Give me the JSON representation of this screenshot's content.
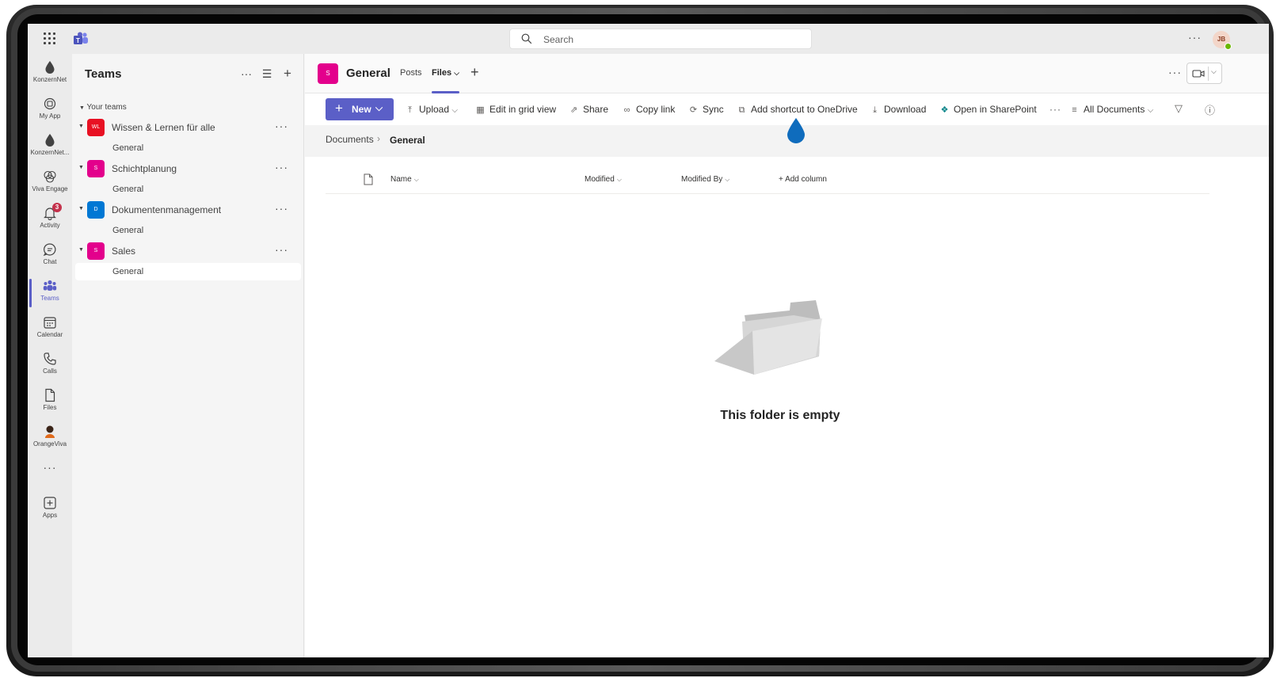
{
  "topbar": {
    "search_placeholder": "Search",
    "user_initials": "JB"
  },
  "rail": {
    "items": [
      {
        "label": "KonzernNet",
        "icon": "drop-icon"
      },
      {
        "label": "My App",
        "icon": "app-icon"
      },
      {
        "label": "KonzernNet...",
        "icon": "drop-icon"
      },
      {
        "label": "Viva Engage",
        "icon": "viva-engage-icon"
      },
      {
        "label": "Activity",
        "icon": "bell-icon",
        "badge": "3"
      },
      {
        "label": "Chat",
        "icon": "chat-icon"
      },
      {
        "label": "Teams",
        "icon": "teams-icon"
      },
      {
        "label": "Calendar",
        "icon": "calendar-icon"
      },
      {
        "label": "Calls",
        "icon": "phone-icon"
      },
      {
        "label": "Files",
        "icon": "file-icon"
      },
      {
        "label": "OrangeViva",
        "icon": "avatar-icon"
      },
      {
        "label": "",
        "icon": "more-icon"
      },
      {
        "label": "Apps",
        "icon": "add-app-icon"
      }
    ]
  },
  "panel": {
    "title": "Teams",
    "section_label": "Your teams",
    "teams": [
      {
        "initials": "WL",
        "name": "Wissen & Lernen für alle",
        "color": "#e81123",
        "channel": "General"
      },
      {
        "initials": "S",
        "name": "Schichtplanung",
        "color": "#e3008c",
        "channel": "General"
      },
      {
        "initials": "D",
        "name": "Dokumentenmanagement",
        "color": "#0078d4",
        "channel": "General"
      },
      {
        "initials": "S",
        "name": "Sales",
        "color": "#e3008c",
        "channel": "General"
      }
    ]
  },
  "channel": {
    "avatar_initials": "S",
    "name": "General",
    "tabs": [
      "Posts",
      "Files"
    ]
  },
  "commands": {
    "new": "New",
    "upload": "Upload",
    "grid": "Edit in grid view",
    "share": "Share",
    "copy_link": "Copy link",
    "sync": "Sync",
    "shortcut": "Add shortcut to OneDrive",
    "download": "Download",
    "sharepoint": "Open in SharePoint",
    "view": "All Documents"
  },
  "breadcrumb": {
    "root": "Documents",
    "current": "General"
  },
  "columns": {
    "name": "Name",
    "modified": "Modified",
    "modified_by": "Modified By",
    "add_column": "+ Add column"
  },
  "empty_state": {
    "text": "This folder is empty"
  },
  "colors": {
    "accent": "#5b5fc7",
    "drop": "#0f6cbd"
  }
}
